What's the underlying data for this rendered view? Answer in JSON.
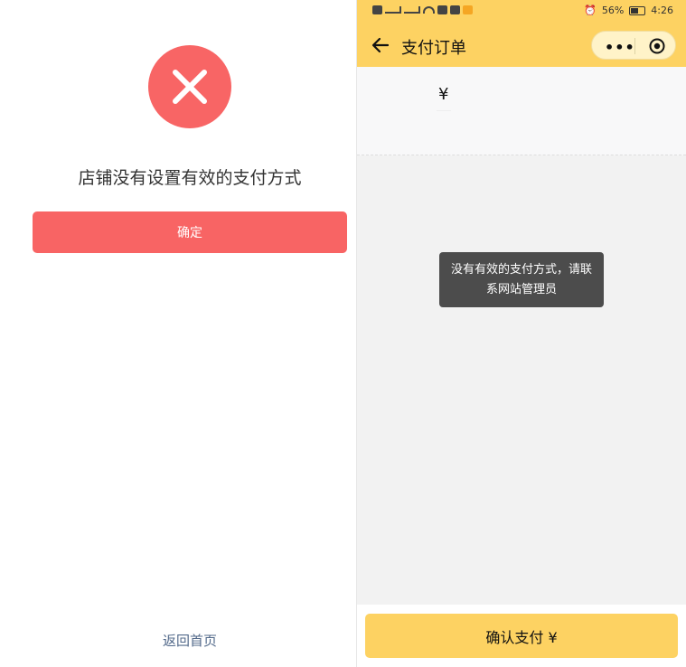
{
  "left": {
    "message": "店铺没有设置有效的支付方式",
    "confirm_label": "确定",
    "home_link": "返回首页"
  },
  "right": {
    "status": {
      "battery": "56%",
      "time": "4:26"
    },
    "title": "支付订单",
    "capsule_dots": "•••",
    "currency": "¥",
    "toast": "没有有效的支付方式，请联系网站管理员",
    "pay_label": "确认支付 ¥"
  },
  "colors": {
    "accent_red": "#f86464",
    "accent_yellow": "#fdd262",
    "toast_bg": "#4c4c4c",
    "link_blue": "#52698a"
  },
  "icons": [
    "error-icon",
    "back-arrow-icon",
    "more-icon",
    "target-icon"
  ]
}
